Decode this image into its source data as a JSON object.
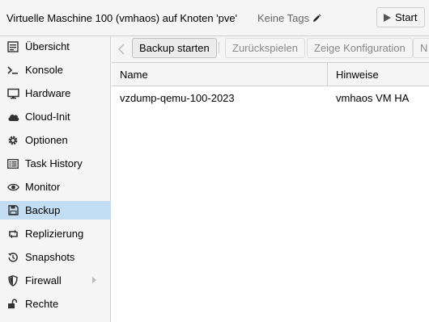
{
  "header": {
    "title": "Virtuelle Maschine 100 (vmhaos) auf Knoten 'pve'",
    "tags_label": "Keine Tags",
    "tags_icon": "pencil-icon",
    "start_label": "Start",
    "start_icon": "play-icon"
  },
  "sidebar": {
    "items": [
      {
        "label": "Übersicht",
        "icon": "summary-icon"
      },
      {
        "label": "Konsole",
        "icon": "terminal-icon"
      },
      {
        "label": "Hardware",
        "icon": "monitor-icon"
      },
      {
        "label": "Cloud-Init",
        "icon": "cloud-icon"
      },
      {
        "label": "Optionen",
        "icon": "gear-icon"
      },
      {
        "label": "Task History",
        "icon": "list-icon"
      },
      {
        "label": "Monitor",
        "icon": "eye-icon"
      },
      {
        "label": "Backup",
        "icon": "floppy-icon",
        "active": true
      },
      {
        "label": "Replizierung",
        "icon": "retweet-icon"
      },
      {
        "label": "Snapshots",
        "icon": "history-icon"
      },
      {
        "label": "Firewall",
        "icon": "shield-icon"
      },
      {
        "label": "Rechte",
        "icon": "unlock-icon"
      }
    ]
  },
  "toolbar": {
    "backup_now": "Backup starten",
    "restore": "Zurückspielen",
    "show_config": "Zeige Konfiguration",
    "next_partial": "N"
  },
  "grid": {
    "columns": [
      "Name",
      "Hinweise"
    ],
    "rows": [
      {
        "name": "vzdump-qemu-100-2023",
        "notes": "vmhaos VM HA"
      }
    ]
  },
  "colors": {
    "active_nav": "#c2ddf2",
    "panel_bg": "#f5f5f5",
    "border": "#cfcfcf"
  }
}
